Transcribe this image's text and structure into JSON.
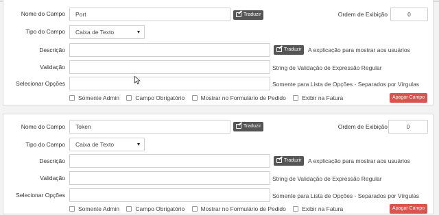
{
  "labels": {
    "field_name": "Nome do Campo",
    "field_type": "Tipo do Campo",
    "description": "Descrição",
    "validation": "Validação",
    "select_options": "Selecionar Opções",
    "display_order": "Ordem de Exibição"
  },
  "buttons": {
    "translate": "Traduzir",
    "delete_field": "Apagar Campo"
  },
  "help": {
    "description": "A explicação para mostrar aos usuários",
    "validation": "String de Validação de Expressão Regular",
    "select_options": "Somente para Lista de Opções - Separados por Vírgulas"
  },
  "checkboxes": {
    "admin_only": "Somente Admin",
    "required": "Campo Obrigatório",
    "show_on_order": "Mostrar no Formulário de Pedido",
    "show_on_invoice": "Exibir na Fatura"
  },
  "fields": [
    {
      "name": "Port",
      "type": "Caixa de Texto",
      "description": "",
      "validation": "",
      "options": "",
      "display_order": "0"
    },
    {
      "name": "Token",
      "type": "Caixa de Texto",
      "description": "",
      "validation": "",
      "options": "",
      "display_order": "0"
    }
  ],
  "icons": {
    "translate": "pencil-square-icon",
    "cursor": "mouse-pointer-icon"
  },
  "colors": {
    "translate_button": "#555555",
    "delete_button": "#d9534f",
    "background": "#f3f3f3"
  }
}
